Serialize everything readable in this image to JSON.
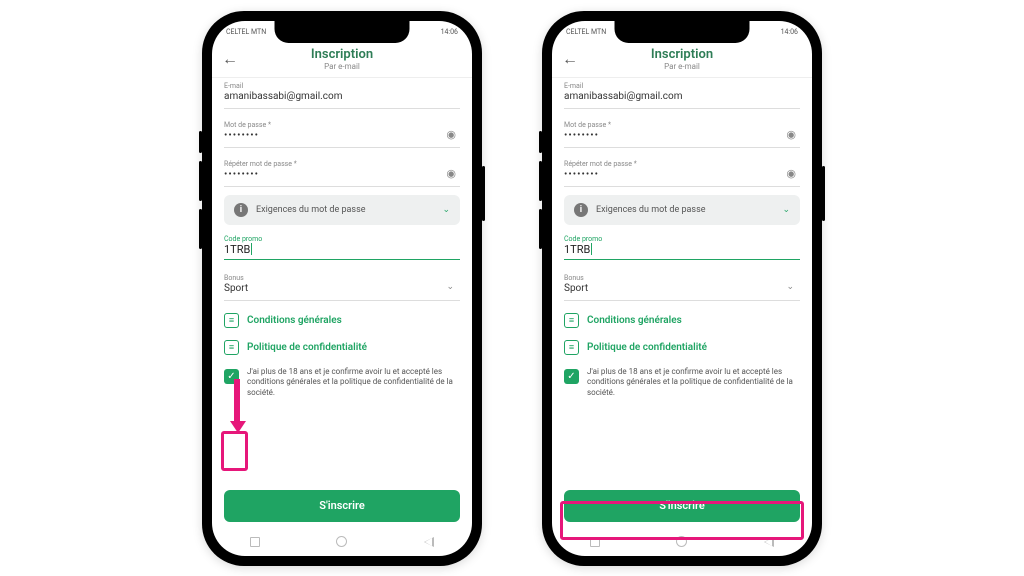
{
  "statusbar": {
    "carrier": "CELTEL MTN",
    "time": "14:06"
  },
  "header": {
    "title": "Inscription",
    "subtitle": "Par e-mail"
  },
  "form": {
    "email_label": "E-mail",
    "email_value": "amanibassabi@gmail.com",
    "password_label": "Mot de passe *",
    "password_value": "••••••••",
    "repeat_label": "Répéter mot de passe *",
    "repeat_value": "••••••••",
    "requirements": "Exigences du mot de passe",
    "promo_label": "Code promo",
    "promo_value": "1TRB",
    "bonus_label": "Bonus",
    "bonus_value": "Sport"
  },
  "links": {
    "terms": "Conditions générales",
    "privacy": "Politique de confidentialité"
  },
  "consent": {
    "text": "J'ai plus de 18 ans et je confirme avoir lu et accepté les conditions générales et la politique de confidentialité de la société."
  },
  "buttons": {
    "signup": "S'inscrire"
  }
}
